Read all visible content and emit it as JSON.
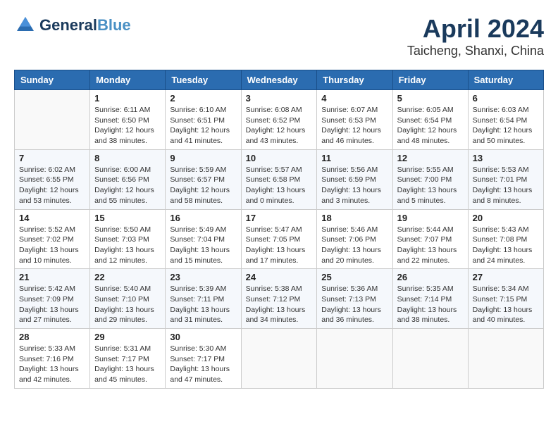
{
  "header": {
    "logo_line1": "General",
    "logo_line2": "Blue",
    "month_year": "April 2024",
    "location": "Taicheng, Shanxi, China"
  },
  "weekdays": [
    "Sunday",
    "Monday",
    "Tuesday",
    "Wednesday",
    "Thursday",
    "Friday",
    "Saturday"
  ],
  "weeks": [
    [
      {
        "day": "",
        "info": ""
      },
      {
        "day": "1",
        "info": "Sunrise: 6:11 AM\nSunset: 6:50 PM\nDaylight: 12 hours\nand 38 minutes."
      },
      {
        "day": "2",
        "info": "Sunrise: 6:10 AM\nSunset: 6:51 PM\nDaylight: 12 hours\nand 41 minutes."
      },
      {
        "day": "3",
        "info": "Sunrise: 6:08 AM\nSunset: 6:52 PM\nDaylight: 12 hours\nand 43 minutes."
      },
      {
        "day": "4",
        "info": "Sunrise: 6:07 AM\nSunset: 6:53 PM\nDaylight: 12 hours\nand 46 minutes."
      },
      {
        "day": "5",
        "info": "Sunrise: 6:05 AM\nSunset: 6:54 PM\nDaylight: 12 hours\nand 48 minutes."
      },
      {
        "day": "6",
        "info": "Sunrise: 6:03 AM\nSunset: 6:54 PM\nDaylight: 12 hours\nand 50 minutes."
      }
    ],
    [
      {
        "day": "7",
        "info": "Sunrise: 6:02 AM\nSunset: 6:55 PM\nDaylight: 12 hours\nand 53 minutes."
      },
      {
        "day": "8",
        "info": "Sunrise: 6:00 AM\nSunset: 6:56 PM\nDaylight: 12 hours\nand 55 minutes."
      },
      {
        "day": "9",
        "info": "Sunrise: 5:59 AM\nSunset: 6:57 PM\nDaylight: 12 hours\nand 58 minutes."
      },
      {
        "day": "10",
        "info": "Sunrise: 5:57 AM\nSunset: 6:58 PM\nDaylight: 13 hours\nand 0 minutes."
      },
      {
        "day": "11",
        "info": "Sunrise: 5:56 AM\nSunset: 6:59 PM\nDaylight: 13 hours\nand 3 minutes."
      },
      {
        "day": "12",
        "info": "Sunrise: 5:55 AM\nSunset: 7:00 PM\nDaylight: 13 hours\nand 5 minutes."
      },
      {
        "day": "13",
        "info": "Sunrise: 5:53 AM\nSunset: 7:01 PM\nDaylight: 13 hours\nand 8 minutes."
      }
    ],
    [
      {
        "day": "14",
        "info": "Sunrise: 5:52 AM\nSunset: 7:02 PM\nDaylight: 13 hours\nand 10 minutes."
      },
      {
        "day": "15",
        "info": "Sunrise: 5:50 AM\nSunset: 7:03 PM\nDaylight: 13 hours\nand 12 minutes."
      },
      {
        "day": "16",
        "info": "Sunrise: 5:49 AM\nSunset: 7:04 PM\nDaylight: 13 hours\nand 15 minutes."
      },
      {
        "day": "17",
        "info": "Sunrise: 5:47 AM\nSunset: 7:05 PM\nDaylight: 13 hours\nand 17 minutes."
      },
      {
        "day": "18",
        "info": "Sunrise: 5:46 AM\nSunset: 7:06 PM\nDaylight: 13 hours\nand 20 minutes."
      },
      {
        "day": "19",
        "info": "Sunrise: 5:44 AM\nSunset: 7:07 PM\nDaylight: 13 hours\nand 22 minutes."
      },
      {
        "day": "20",
        "info": "Sunrise: 5:43 AM\nSunset: 7:08 PM\nDaylight: 13 hours\nand 24 minutes."
      }
    ],
    [
      {
        "day": "21",
        "info": "Sunrise: 5:42 AM\nSunset: 7:09 PM\nDaylight: 13 hours\nand 27 minutes."
      },
      {
        "day": "22",
        "info": "Sunrise: 5:40 AM\nSunset: 7:10 PM\nDaylight: 13 hours\nand 29 minutes."
      },
      {
        "day": "23",
        "info": "Sunrise: 5:39 AM\nSunset: 7:11 PM\nDaylight: 13 hours\nand 31 minutes."
      },
      {
        "day": "24",
        "info": "Sunrise: 5:38 AM\nSunset: 7:12 PM\nDaylight: 13 hours\nand 34 minutes."
      },
      {
        "day": "25",
        "info": "Sunrise: 5:36 AM\nSunset: 7:13 PM\nDaylight: 13 hours\nand 36 minutes."
      },
      {
        "day": "26",
        "info": "Sunrise: 5:35 AM\nSunset: 7:14 PM\nDaylight: 13 hours\nand 38 minutes."
      },
      {
        "day": "27",
        "info": "Sunrise: 5:34 AM\nSunset: 7:15 PM\nDaylight: 13 hours\nand 40 minutes."
      }
    ],
    [
      {
        "day": "28",
        "info": "Sunrise: 5:33 AM\nSunset: 7:16 PM\nDaylight: 13 hours\nand 42 minutes."
      },
      {
        "day": "29",
        "info": "Sunrise: 5:31 AM\nSunset: 7:17 PM\nDaylight: 13 hours\nand 45 minutes."
      },
      {
        "day": "30",
        "info": "Sunrise: 5:30 AM\nSunset: 7:17 PM\nDaylight: 13 hours\nand 47 minutes."
      },
      {
        "day": "",
        "info": ""
      },
      {
        "day": "",
        "info": ""
      },
      {
        "day": "",
        "info": ""
      },
      {
        "day": "",
        "info": ""
      }
    ]
  ]
}
